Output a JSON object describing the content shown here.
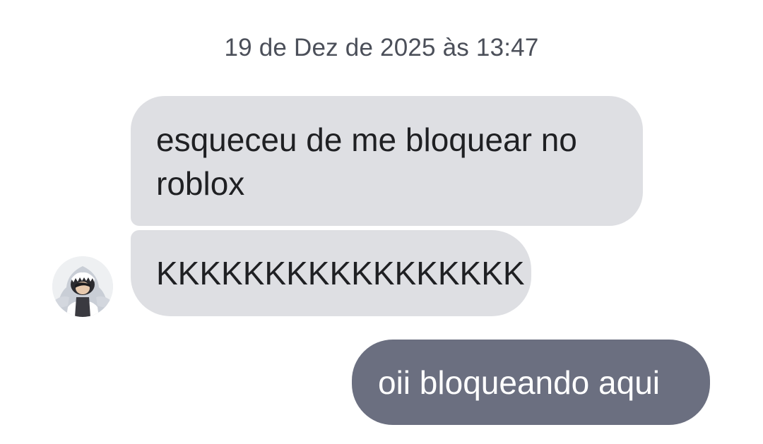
{
  "timestamp": "19 de Dez de 2025 às 13:47",
  "messages": [
    {
      "sender": "contact",
      "text": "esqueceu de me bloquear no roblox"
    },
    {
      "sender": "contact",
      "text": "KKKKKKKKKKKKKKKKK"
    },
    {
      "sender": "me",
      "text": "oii bloqueando aqui"
    }
  ],
  "colors": {
    "incoming_bubble": "#dedfe3",
    "outgoing_bubble": "#6b6f80",
    "timestamp_text": "#4b4f59"
  },
  "contact": {
    "avatar_icon": "roblox-shark-avatar-icon"
  }
}
